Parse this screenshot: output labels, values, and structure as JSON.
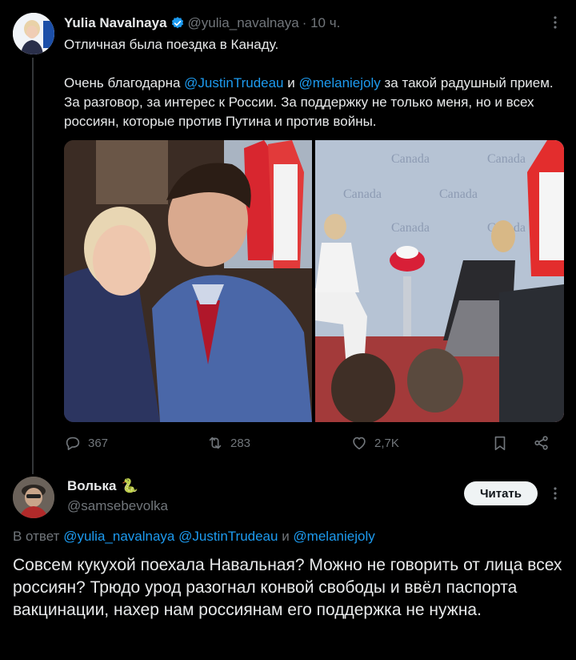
{
  "tweet": {
    "author_name": "Yulia Navalnaya",
    "handle": "@yulia_navalnaya",
    "time": "· 10 ч.",
    "text_line1": "Отличная была поездка в Канаду.",
    "text_p2_a": "Очень благодарна ",
    "mention_1": "@JustinTrudeau",
    "text_p2_b": " и ",
    "mention_2": "@melaniejoly",
    "text_p2_c": " за такой радушный прием. За разговор, за интерес к России. За поддержку не только меня, но и всех россиян, которые против Путина и против войны.",
    "photo2_backdrop_word": "Canada",
    "stats": {
      "replies": "367",
      "retweets": "283",
      "likes": "2,7K"
    }
  },
  "reply": {
    "author_name": "Волька",
    "handle": "@samsebevolka",
    "follow_label": "Читать",
    "reply_prefix": "В ответ",
    "reply_mention_1": "@yulia_navalnaya",
    "reply_mention_2": "@JustinTrudeau",
    "reply_and": " и ",
    "reply_mention_3": "@melaniejoly",
    "text": "Совсем кукухой поехала Навальная? Можно не говорить от лица всех россиян? Трюдо урод разогнал конвой свободы и ввёл паспорта вакцинации, нахер нам россиянам его поддержка не нужна."
  },
  "colors": {
    "background": "#000000",
    "text": "#e7e9ea",
    "secondary": "#71767b",
    "accent": "#1d9bf0",
    "verified": "#1d9bf0",
    "follow_bg": "#eff3f4"
  },
  "icons": [
    "verified-badge-icon",
    "more-options-icon",
    "reply-icon",
    "retweet-icon",
    "like-icon",
    "bookmark-icon",
    "share-icon",
    "snake-emoji-icon"
  ]
}
